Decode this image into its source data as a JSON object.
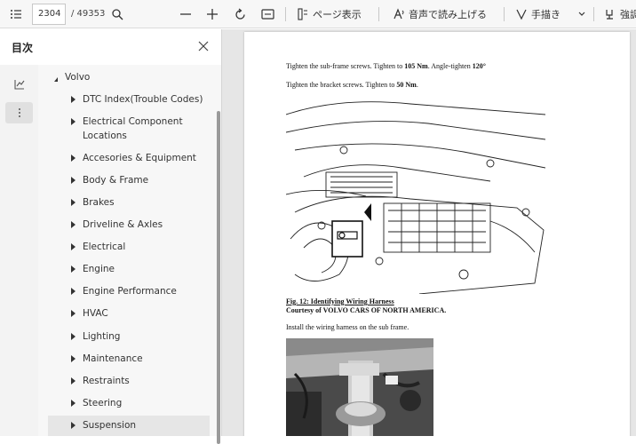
{
  "toolbar": {
    "current_page": "2304",
    "total_pages": "/ 49353",
    "page_view_label": "ページ表示",
    "read_aloud_label": "音声で読み上げる",
    "draw_label": "手描き",
    "more_label": "強調"
  },
  "sidebar": {
    "title": "目次",
    "root": "Volvo",
    "items": [
      {
        "label": "DTC Index(Trouble Codes)"
      },
      {
        "label": "Electrical Component",
        "label2": "Locations"
      },
      {
        "label": "Accesories & Equipment"
      },
      {
        "label": "Body & Frame"
      },
      {
        "label": "Brakes"
      },
      {
        "label": "Driveline & Axles"
      },
      {
        "label": "Electrical"
      },
      {
        "label": "Engine"
      },
      {
        "label": "Engine Performance"
      },
      {
        "label": "HVAC"
      },
      {
        "label": "Lighting"
      },
      {
        "label": "Maintenance"
      },
      {
        "label": "Restraints"
      },
      {
        "label": "Steering"
      },
      {
        "label": "Suspension"
      }
    ]
  },
  "document": {
    "line1_a": "Tighten the sub-frame screws. Tighten to ",
    "line1_b": "105 Nm",
    "line1_c": ". Angle-tighten ",
    "line1_d": "120°",
    "line2_a": "Tighten the bracket screws. Tighten to ",
    "line2_b": "50 Nm",
    "line2_c": ".",
    "caption": "Fig. 12: Identifying Wiring Harness",
    "courtesy": "Courtesy of VOLVO CARS OF NORTH AMERICA.",
    "line3": "Install the wiring harness on the sub frame."
  },
  "colors": {
    "toolbar_bg": "#f7f7f7",
    "sidebar_bg": "#f7f7f7",
    "doc_bg": "#e6e6e6",
    "selected_item": "#e6e6e6"
  }
}
